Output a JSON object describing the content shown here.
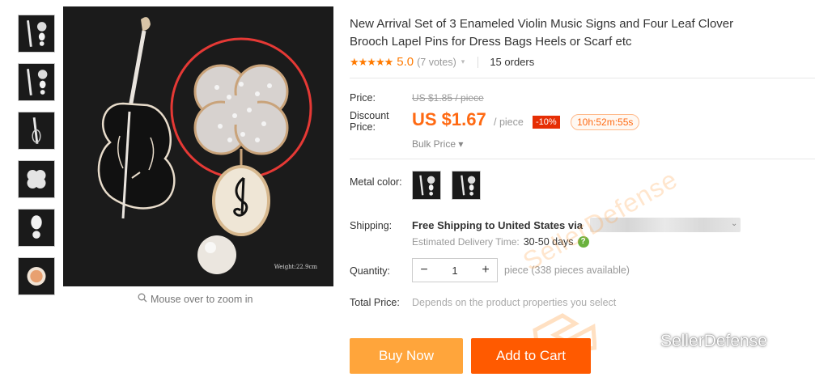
{
  "product": {
    "title_line1": "New Arrival Set of 3 Enameled Violin Music Signs and Four Leaf Clover",
    "title_line2": "Brooch Lapel Pins for Dress Bags Heels or Scarf etc",
    "stars": "★★★★★",
    "rating": "5.0",
    "votes": "(7 votes)",
    "orders": "15 orders"
  },
  "gallery": {
    "zoom_hint": "Mouse over to zoom in",
    "weight_label": "Weight:22.9cm",
    "thumbnail_count": 6
  },
  "price": {
    "label": "Price:",
    "original": "US $1.85 / piece",
    "discount_label_1": "Discount",
    "discount_label_2": "Price:",
    "current": "US $1.67",
    "unit": "/ piece",
    "discount_badge": "-10%",
    "countdown": "10h:52m:55s",
    "bulk": "Bulk Price ▾"
  },
  "options": {
    "metal_color_label": "Metal color:"
  },
  "shipping": {
    "label": "Shipping:",
    "main": "Free Shipping to United States via",
    "estimate_label": "Estimated Delivery Time:",
    "estimate_value": "30-50 days",
    "help_icon": "?"
  },
  "quantity": {
    "label": "Quantity:",
    "minus": "−",
    "value": "1",
    "plus": "+",
    "note": "piece (338 pieces available)"
  },
  "total": {
    "label": "Total Price:",
    "note": "Depends on the product properties you select"
  },
  "actions": {
    "buy_now": "Buy Now",
    "add_to_cart": "Add to Cart"
  },
  "watermark": {
    "diagonal": "SellerDefense",
    "brand": "SellerDefense"
  },
  "colors": {
    "accent_orange": "#ff6a13",
    "buy_now_bg": "#ffa53b",
    "add_to_cart_bg": "#ff5a00",
    "discount_red": "#e62e04",
    "highlight_circle": "#e53935"
  }
}
